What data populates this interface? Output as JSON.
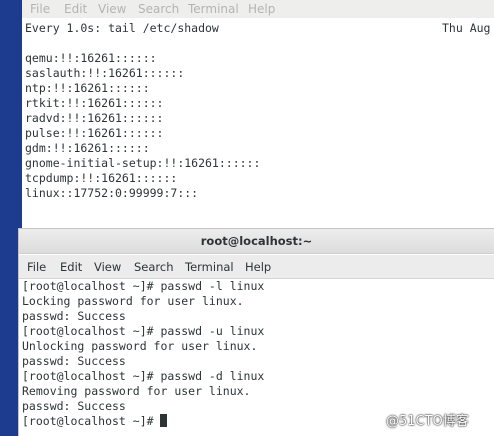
{
  "back_terminal": {
    "menu": [
      "File",
      "Edit",
      "View",
      "Search",
      "Terminal",
      "Help"
    ],
    "watch_header": "Every 1.0s: tail /etc/shadow",
    "watch_time": "Thu Aug",
    "lines": [
      "qemu:!!:16261::::::",
      "saslauth:!!:16261::::::",
      "ntp:!!:16261::::::",
      "rtkit:!!:16261::::::",
      "radvd:!!:16261::::::",
      "pulse:!!:16261::::::",
      "gdm:!!:16261::::::",
      "gnome-initial-setup:!!:16261::::::",
      "tcpdump:!!:16261::::::",
      "linux::17752:0:99999:7:::"
    ]
  },
  "front_terminal": {
    "title": "root@localhost:~",
    "menu": [
      "File",
      "Edit",
      "View",
      "Search",
      "Terminal",
      "Help"
    ],
    "lines": [
      "[root@localhost ~]# passwd -l linux",
      "Locking password for user linux.",
      "passwd: Success",
      "[root@localhost ~]# passwd -u linux",
      "Unlocking password for user linux.",
      "passwd: Success",
      "[root@localhost ~]# passwd -d linux",
      "Removing password for user linux.",
      "passwd: Success"
    ],
    "prompt": "[root@localhost ~]# "
  },
  "watermark": "@51CTO博客",
  "colors": {
    "desktop": "#1e3c8f",
    "terminal_text": "#2e3436",
    "menubar": "#ececec"
  }
}
